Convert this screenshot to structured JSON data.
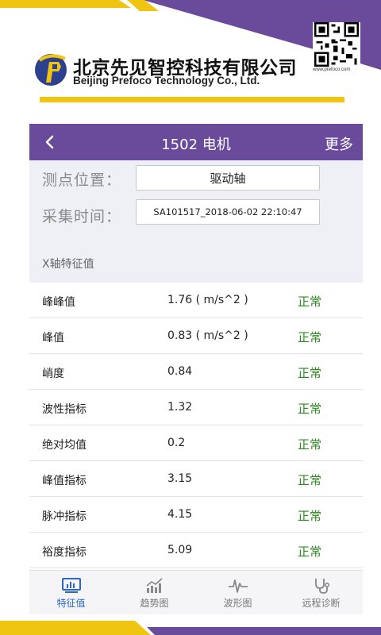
{
  "brand": {
    "name_cn": "北京先见智控科技有限公司",
    "name_en": "Beijing Prefoco Technology Co., Ltd.",
    "url": "www.prefoco.com"
  },
  "navbar": {
    "title": "1502 电机",
    "more_label": "更多"
  },
  "info": {
    "position_label": "测点位置：",
    "position_value": "驱动轴",
    "time_label": "采集时间：",
    "time_value": "SA101517_2018-06-02 22:10:47",
    "section_title": "X轴特征值"
  },
  "features": [
    {
      "name": "峰峰值",
      "value": "1.76 ( m/s^2 )",
      "status": "正常"
    },
    {
      "name": "峰值",
      "value": "0.83 ( m/s^2 )",
      "status": "正常"
    },
    {
      "name": "峭度",
      "value": "0.84",
      "status": "正常"
    },
    {
      "name": "波性指标",
      "value": "1.32",
      "status": "正常"
    },
    {
      "name": "绝对均值",
      "value": "0.2",
      "status": "正常"
    },
    {
      "name": "峰值指标",
      "value": "3.15",
      "status": "正常"
    },
    {
      "name": "脉冲指标",
      "value": "4.15",
      "status": "正常"
    },
    {
      "name": "裕度指标",
      "value": "5.09",
      "status": "正常"
    }
  ],
  "tabs": [
    {
      "label": "特征值",
      "icon": "feature-monitor-icon",
      "active": true
    },
    {
      "label": "趋势图",
      "icon": "trend-chart-icon",
      "active": false
    },
    {
      "label": "波形图",
      "icon": "waveform-icon",
      "active": false
    },
    {
      "label": "远程诊断",
      "icon": "stethoscope-icon",
      "active": false
    }
  ],
  "colors": {
    "brand_purple": "#6a4b9b",
    "brand_yellow": "#f0c512",
    "status_normal": "#2b8a1f",
    "tab_active": "#2e66c8"
  }
}
